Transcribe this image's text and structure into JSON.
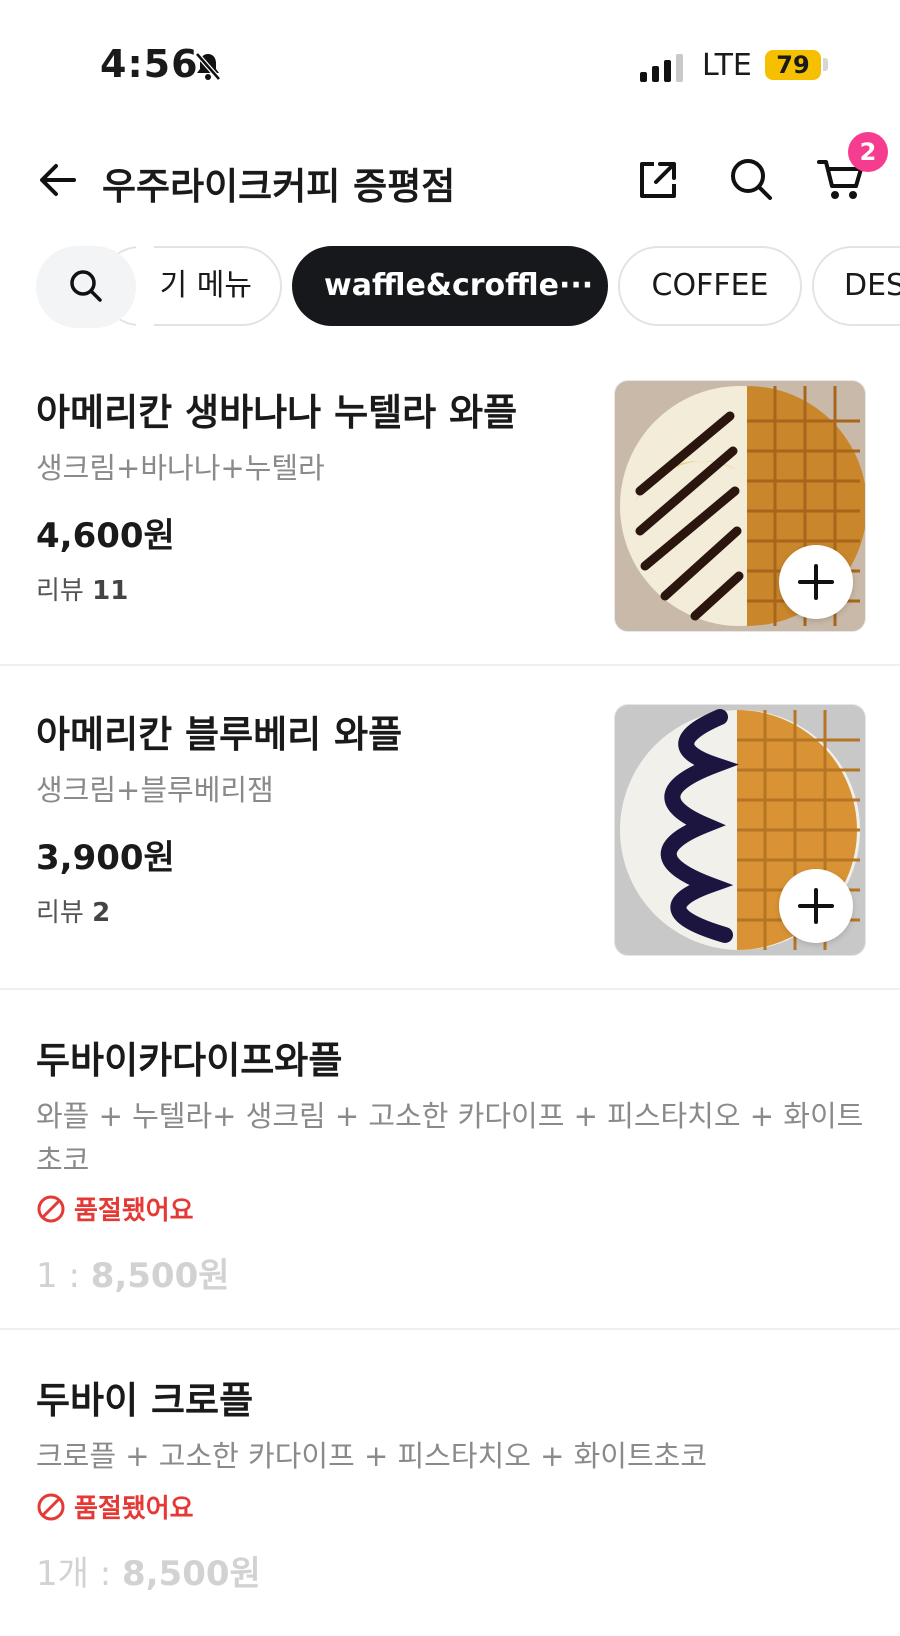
{
  "status_bar": {
    "time": "4:56",
    "network": "LTE",
    "battery": "79"
  },
  "header": {
    "title": "우주라이크커피 증평점",
    "cart_count": "2"
  },
  "categories": [
    {
      "label": "인기 메뉴",
      "visible": "기 메뉴"
    },
    {
      "label": "waffle&croffle···",
      "active": true
    },
    {
      "label": "COFFEE"
    },
    {
      "label": "DES"
    }
  ],
  "items": [
    {
      "name": "아메리칸 생바나나 누텔라 와플",
      "desc": "생크림+바나나+누텔라",
      "price": "4,600원",
      "review_label": "리뷰",
      "review_count": "11",
      "sauce_color": "#2a160e",
      "base_color": "#e8d07a"
    },
    {
      "name": "아메리칸 블루베리 와플",
      "desc": "생크림+블루베리잼",
      "price": "3,900원",
      "review_label": "리뷰",
      "review_count": "2",
      "sauce_color": "#1c1540",
      "base_color": "#f2f0ea"
    },
    {
      "name": "두바이카다이프와플",
      "desc": "와플 + 누텔라+ 생크림 + 고소한 카다이프 + 피스타치오 + 화이트초코",
      "soldout": "품절됐어요",
      "price_prefix": "1 : ",
      "price": "8,500원"
    },
    {
      "name": "두바이 크로플",
      "desc": "크로플 + 고소한 카다이프 + 피스타치오 + 화이트초코",
      "soldout": "품절됐어요",
      "price_prefix": "1개 : ",
      "price": "8,500원"
    }
  ],
  "colors": {
    "accent": "#f53c8f",
    "soldout": "#e53935",
    "active_chip": "#16181b"
  }
}
